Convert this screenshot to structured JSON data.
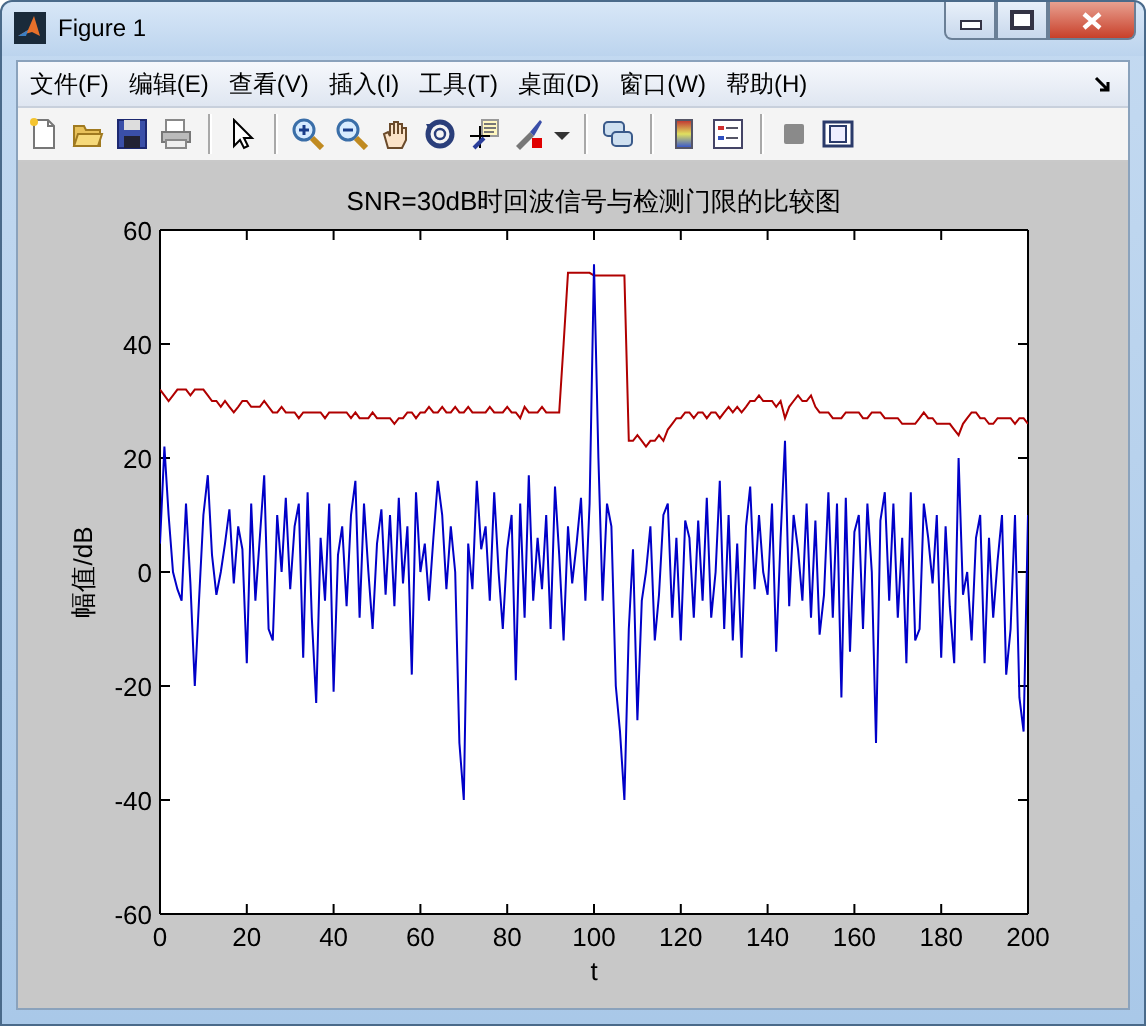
{
  "window": {
    "title": "Figure 1"
  },
  "menu": [
    {
      "label": "文件(F)"
    },
    {
      "label": "编辑(E)"
    },
    {
      "label": "查看(V)"
    },
    {
      "label": "插入(I)"
    },
    {
      "label": "工具(T)"
    },
    {
      "label": "桌面(D)"
    },
    {
      "label": "窗口(W)"
    },
    {
      "label": "帮助(H)"
    }
  ],
  "figure": {
    "axes": {
      "chart_data": {
        "type": "line",
        "title": "SNR=30dB时回波信号与检测门限的比较图",
        "xlabel": "t",
        "ylabel": "幅值/dB",
        "xlim": [
          0,
          200
        ],
        "ylim": [
          -60,
          60
        ],
        "xticks": [
          0,
          20,
          40,
          60,
          80,
          100,
          120,
          140,
          160,
          180,
          200
        ],
        "yticks": [
          -60,
          -40,
          -20,
          0,
          20,
          40,
          60
        ],
        "x": [
          0,
          1,
          2,
          3,
          4,
          5,
          6,
          7,
          8,
          9,
          10,
          11,
          12,
          13,
          14,
          15,
          16,
          17,
          18,
          19,
          20,
          21,
          22,
          23,
          24,
          25,
          26,
          27,
          28,
          29,
          30,
          31,
          32,
          33,
          34,
          35,
          36,
          37,
          38,
          39,
          40,
          41,
          42,
          43,
          44,
          45,
          46,
          47,
          48,
          49,
          50,
          51,
          52,
          53,
          54,
          55,
          56,
          57,
          58,
          59,
          60,
          61,
          62,
          63,
          64,
          65,
          66,
          67,
          68,
          69,
          70,
          71,
          72,
          73,
          74,
          75,
          76,
          77,
          78,
          79,
          80,
          81,
          82,
          83,
          84,
          85,
          86,
          87,
          88,
          89,
          90,
          91,
          92,
          93,
          94,
          95,
          96,
          97,
          98,
          99,
          100,
          101,
          102,
          103,
          104,
          105,
          106,
          107,
          108,
          109,
          110,
          111,
          112,
          113,
          114,
          115,
          116,
          117,
          118,
          119,
          120,
          121,
          122,
          123,
          124,
          125,
          126,
          127,
          128,
          129,
          130,
          131,
          132,
          133,
          134,
          135,
          136,
          137,
          138,
          139,
          140,
          141,
          142,
          143,
          144,
          145,
          146,
          147,
          148,
          149,
          150,
          151,
          152,
          153,
          154,
          155,
          156,
          157,
          158,
          159,
          160,
          161,
          162,
          163,
          164,
          165,
          166,
          167,
          168,
          169,
          170,
          171,
          172,
          173,
          174,
          175,
          176,
          177,
          178,
          179,
          180,
          181,
          182,
          183,
          184,
          185,
          186,
          187,
          188,
          189,
          190,
          191,
          192,
          193,
          194,
          195,
          196,
          197,
          198,
          199,
          200
        ],
        "series": [
          {
            "color": "#b00000",
            "values": [
              32,
              31,
              30,
              31,
              32,
              32,
              32,
              31,
              32,
              32,
              32,
              31,
              30,
              30,
              29,
              30,
              29,
              28,
              29,
              30,
              30,
              29,
              29,
              29,
              30,
              29,
              28,
              28,
              29,
              28,
              28,
              28,
              27,
              28,
              28,
              28,
              28,
              28,
              27,
              28,
              28,
              28,
              28,
              28,
              27,
              28,
              27,
              27,
              27,
              28,
              27,
              27,
              27,
              27,
              26,
              27,
              27,
              28,
              28,
              27,
              28,
              28,
              29,
              28,
              28,
              29,
              28,
              28,
              29,
              28,
              28,
              29,
              28,
              28,
              28,
              28,
              29,
              28,
              28,
              28,
              29,
              28,
              28,
              27,
              29,
              28,
              28,
              28,
              29,
              28,
              28,
              28,
              28,
              40,
              52.5,
              52.5,
              52.5,
              52.5,
              52.5,
              52.5,
              52,
              52,
              52,
              52,
              52,
              52,
              52,
              52,
              23,
              23,
              24,
              23,
              22,
              23,
              23,
              24,
              23,
              25,
              26,
              27,
              27,
              28,
              28,
              27,
              28,
              28,
              27,
              28,
              28,
              27,
              28,
              29,
              28,
              29,
              28,
              29,
              30,
              30,
              31,
              30,
              30,
              30,
              29,
              30,
              27,
              29,
              30,
              31,
              30,
              30,
              31,
              29,
              28,
              28,
              28,
              27,
              27,
              27,
              28,
              28,
              28,
              28,
              27,
              27,
              28,
              28,
              28,
              27,
              27,
              27,
              27,
              26,
              26,
              26,
              26,
              27,
              28,
              27,
              27,
              26,
              26,
              26,
              26,
              25,
              24,
              26,
              27,
              28,
              28,
              27,
              27,
              26,
              26,
              27,
              27,
              27,
              27,
              26,
              27,
              27,
              26
            ]
          },
          {
            "color": "#0000c8",
            "values": [
              5,
              22,
              10,
              0,
              -3,
              -5,
              12,
              -2,
              -20,
              -5,
              10,
              17,
              3,
              -4,
              0,
              5,
              11,
              -2,
              8,
              4,
              -16,
              12,
              -5,
              6,
              17,
              -10,
              -12,
              10,
              0,
              13,
              -3,
              8,
              12,
              -15,
              14,
              -8,
              -23,
              6,
              -5,
              12,
              -21,
              3,
              8,
              -6,
              10,
              16,
              -8,
              12,
              0,
              -10,
              5,
              11,
              -4,
              10,
              -6,
              13,
              -2,
              8,
              -18,
              14,
              0,
              5,
              -5,
              6,
              16,
              10,
              -3,
              8,
              0,
              -30,
              -40,
              5,
              -3,
              16,
              4,
              8,
              -5,
              14,
              0,
              -10,
              4,
              10,
              -19,
              12,
              -8,
              17,
              -5,
              6,
              -3,
              10,
              -10,
              15,
              3,
              -12,
              8,
              -2,
              5,
              13,
              -5,
              12,
              54,
              20,
              -5,
              12,
              8,
              -20,
              -28,
              -40,
              -10,
              4,
              -26,
              -5,
              0,
              8,
              -12,
              -4,
              10,
              12,
              -8,
              6,
              -12,
              9,
              6,
              -8,
              9,
              -5,
              13,
              -8,
              0,
              16,
              -10,
              10,
              -12,
              5,
              -15,
              8,
              15,
              -3,
              10,
              0,
              -4,
              12,
              -14,
              6,
              23,
              -6,
              10,
              4,
              -5,
              12,
              -8,
              9,
              -11,
              -4,
              14,
              -8,
              12,
              -22,
              13,
              -14,
              7,
              10,
              -10,
              12,
              0,
              -30,
              9,
              14,
              -5,
              12,
              -8,
              6,
              -16,
              14,
              -12,
              -10,
              12,
              6,
              -2,
              10,
              -15,
              8,
              -6,
              -16,
              20,
              -4,
              0,
              -12,
              6,
              10,
              -16,
              6,
              -8,
              2,
              10,
              -18,
              -10,
              10,
              -22,
              -28,
              10
            ]
          }
        ]
      }
    }
  }
}
